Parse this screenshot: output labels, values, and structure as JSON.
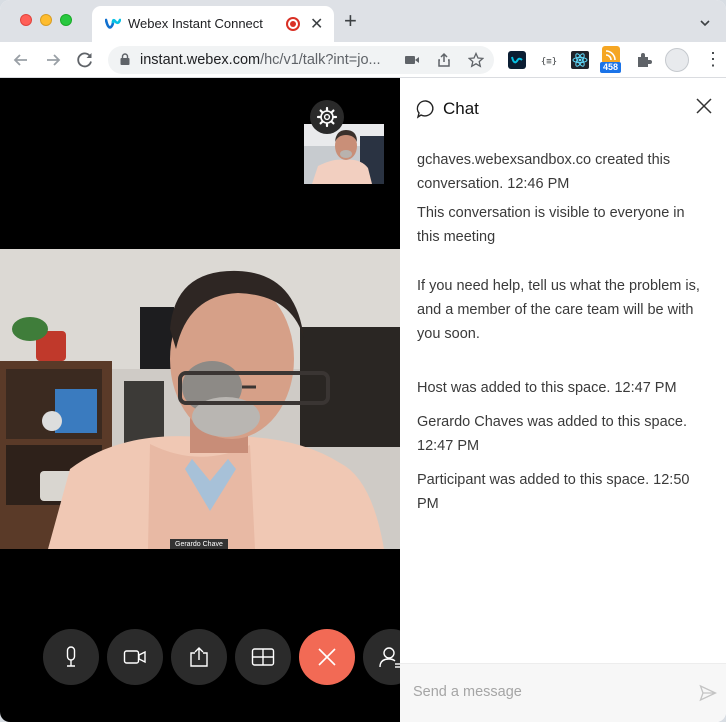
{
  "browser": {
    "tab_title": "Webex Instant Connect",
    "url_host": "instant.webex.com",
    "url_path": "/hc/v1/talk?int=jo...",
    "extension_badge": "458"
  },
  "video": {
    "participant_name": "Gerardo Chave"
  },
  "chat": {
    "title": "Chat",
    "messages": [
      "gchaves.webexsandbox.co created this conversation. 12:46 PM",
      "This conversation is visible to everyone in this meeting",
      "If you need help, tell us what the problem is, and a member of the care team will be with you soon.",
      "Host was added to this space. 12:47 PM",
      "Gerardo Chaves was added to this space. 12:47 PM",
      "Participant was added to this space. 12:50 PM"
    ],
    "composer_placeholder": "Send a message"
  },
  "colors": {
    "end_call": "#f26a55",
    "control_bg": "#2b2b2b",
    "record_dot": "#d93025"
  }
}
